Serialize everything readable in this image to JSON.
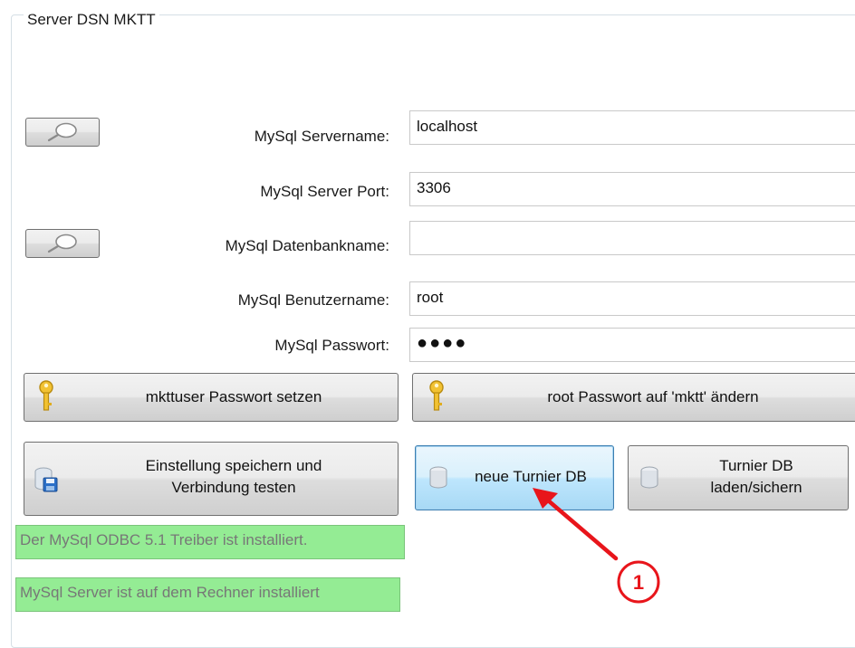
{
  "group": {
    "title": "Server DSN MKTT"
  },
  "fields": {
    "servername": {
      "label": "MySql Servername:",
      "value": "localhost"
    },
    "port": {
      "label": "MySql Server Port:",
      "value": "3306"
    },
    "dbname": {
      "label": "MySql Datenbankname:",
      "value": ""
    },
    "username": {
      "label": "MySql Benutzername:",
      "value": "root"
    },
    "password": {
      "label": "MySql Passwort:",
      "value": "●●●●"
    }
  },
  "buttons": {
    "mkttuser_pw": "mkttuser Passwort setzen",
    "root_pw": "root Passwort auf 'mktt' ändern",
    "save_line1": "Einstellung speichern und",
    "save_line2": "Verbindung testen",
    "new_db": "neue Turnier DB",
    "load_line1": "Turnier DB",
    "load_line2": "laden/sichern"
  },
  "status": {
    "odbc": "Der MySql ODBC 5.1 Treiber ist installiert.",
    "server": "MySql Server ist auf dem Rechner installiert"
  },
  "annotation": {
    "number": "1",
    "color": "#e8151b"
  },
  "icons": [
    "search-icon",
    "key-icon",
    "save-db-icon",
    "database-icon"
  ]
}
